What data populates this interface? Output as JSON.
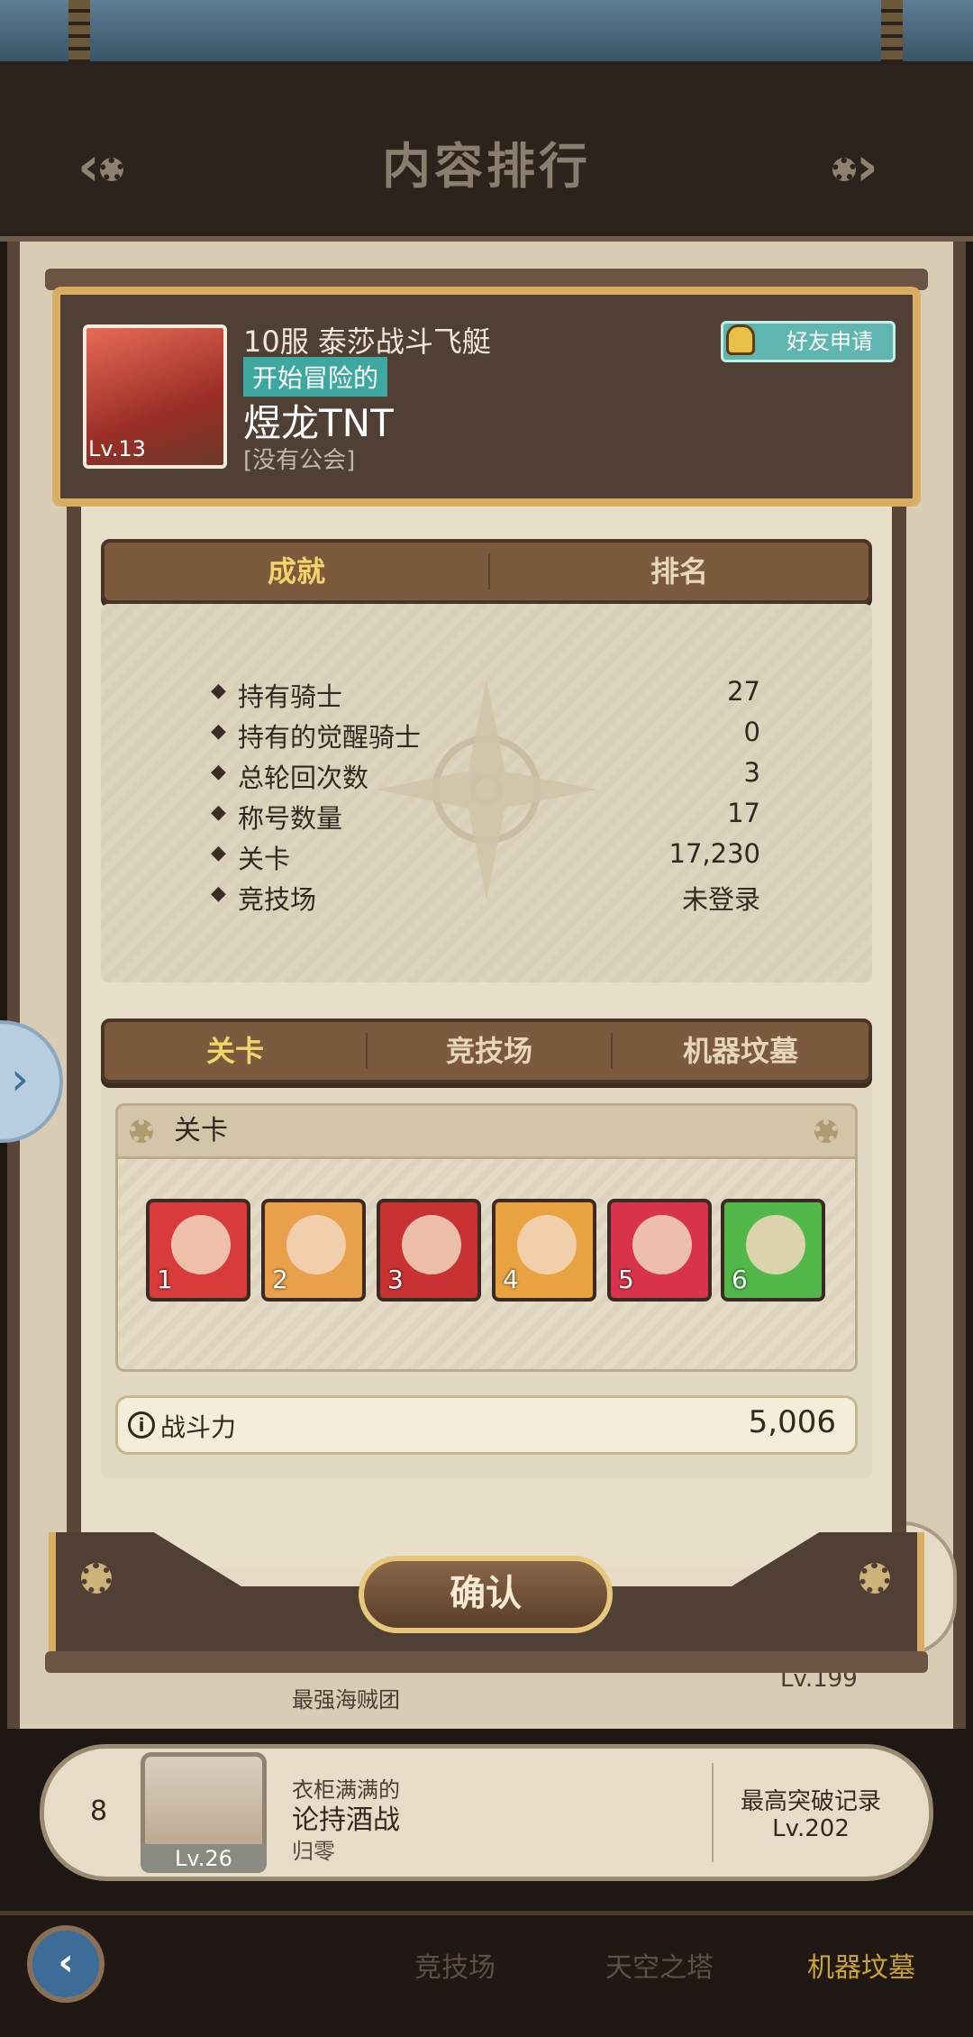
{
  "header": {
    "title": "内容排行"
  },
  "profile": {
    "server_and_airship": "10服 泰莎战斗飞艇",
    "title_badge": "开始冒险的",
    "player_name": "煜龙TNT",
    "guild": "[没有公会]",
    "avatar_level": "Lv.13",
    "friend_button": "好友申请"
  },
  "top_tabs": [
    {
      "label": "成就",
      "active": true
    },
    {
      "label": "排名",
      "active": false
    }
  ],
  "stats": [
    {
      "label": "持有骑士",
      "value": "27"
    },
    {
      "label": "持有的觉醒骑士",
      "value": "0"
    },
    {
      "label": "总轮回次数",
      "value": "3"
    },
    {
      "label": "称号数量",
      "value": "17"
    },
    {
      "label": "关卡",
      "value": "17,230"
    },
    {
      "label": "竞技场",
      "value": "未登录"
    }
  ],
  "mode_tabs": [
    {
      "label": "关卡",
      "active": true
    },
    {
      "label": "竞技场",
      "active": false
    },
    {
      "label": "机器坟墓",
      "active": false
    }
  ],
  "stage_section": {
    "title": "关卡",
    "heroes": [
      {
        "slot": "1",
        "color": "#d93a3a"
      },
      {
        "slot": "2",
        "color": "#e9a04a"
      },
      {
        "slot": "3",
        "color": "#c83232"
      },
      {
        "slot": "4",
        "color": "#e8a340"
      },
      {
        "slot": "5",
        "color": "#d8334a"
      },
      {
        "slot": "6",
        "color": "#52b84a"
      }
    ],
    "power_label": "战斗力",
    "power_value": "5,006"
  },
  "confirm_button": "确认",
  "list_rows": {
    "row7": {
      "guild": "最强海贼团",
      "level": "Lv.199"
    },
    "row8": {
      "rank": "8",
      "avatar_level": "Lv.26",
      "title": "衣柜满满的",
      "name": "论持酒战",
      "guild": "归零",
      "record_label": "最高突破记录",
      "record_level": "Lv.202"
    }
  },
  "bottom_tabs": [
    {
      "label": "竞技场",
      "active": false
    },
    {
      "label": "天空之塔",
      "active": false
    },
    {
      "label": "机器坟墓",
      "active": true
    }
  ],
  "colors": {
    "accent_gold": "#d9ad62",
    "panel_brown": "#4f3f35",
    "teal_badge": "#3ea8a0"
  }
}
